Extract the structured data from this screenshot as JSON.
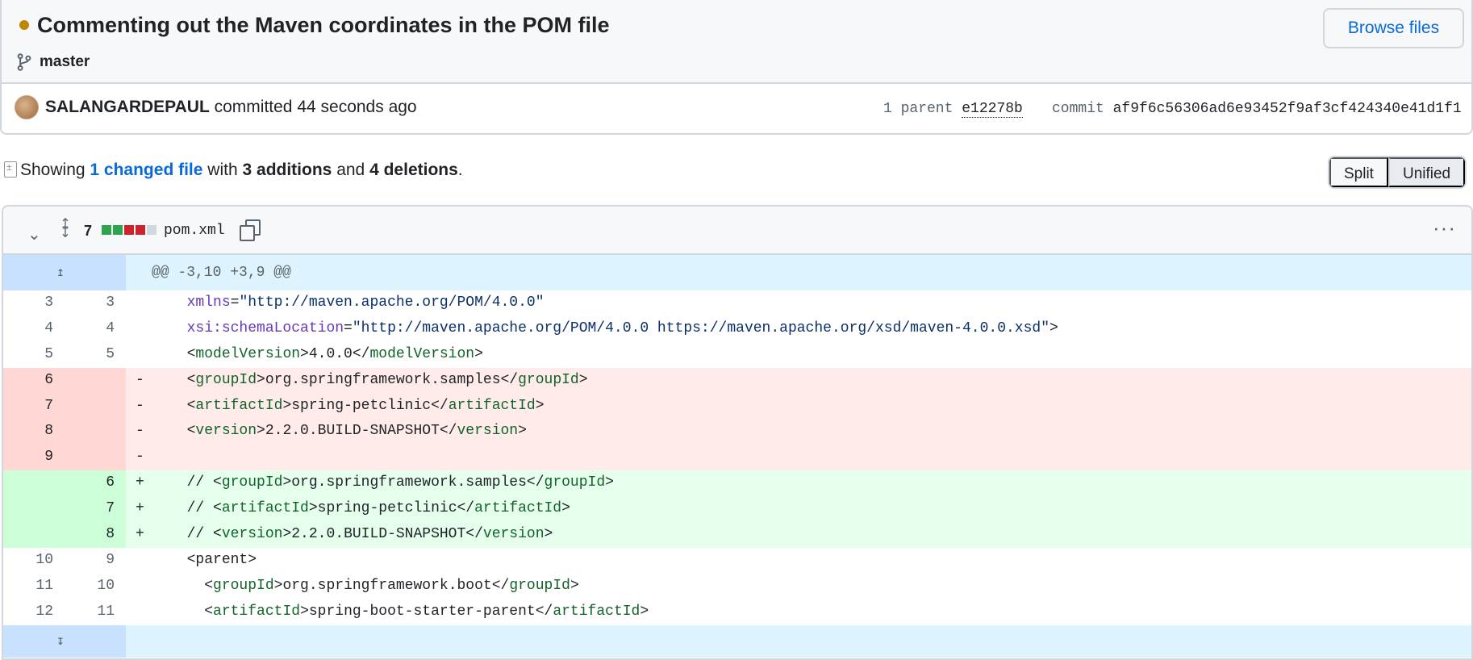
{
  "commit": {
    "title": "Commenting out the Maven coordinates in the POM file",
    "branch": "master",
    "browse_label": "Browse files",
    "author": "SALANGARDEPAUL",
    "committed_text": "committed",
    "time_ago": "44 seconds ago",
    "parent_label": "1 parent",
    "parent_sha": "e12278b",
    "commit_label": "commit",
    "commit_sha": "af9f6c56306ad6e93452f9af3cf424340e41d1f1",
    "status_color": "#bf8700"
  },
  "summary": {
    "prefix": "Showing",
    "changed_link": "1 changed file",
    "with": "with",
    "additions": "3 additions",
    "and": "and",
    "deletions": "4 deletions",
    "suffix": "."
  },
  "view_toggle": {
    "split_label": "Split",
    "unified_label": "Unified",
    "selected": "Unified"
  },
  "file": {
    "change_count": "7",
    "diffstat": [
      "add",
      "add",
      "del",
      "del",
      "neutral"
    ],
    "name": "pom.xml",
    "hunk_header": "@@ -3,10 +3,9 @@"
  },
  "diff_lines": [
    {
      "type": "ctx",
      "old": "3",
      "new": "3",
      "marker": " ",
      "indent": "  ",
      "prefix": "",
      "tokens": [
        [
          "attr",
          "xmlns"
        ],
        [
          "plain",
          "="
        ],
        [
          "str",
          "\"http://maven.apache.org/POM/4.0.0\""
        ]
      ]
    },
    {
      "type": "ctx",
      "old": "4",
      "new": "4",
      "marker": " ",
      "indent": "  ",
      "prefix": "",
      "tokens": [
        [
          "attr",
          "xsi:schemaLocation"
        ],
        [
          "plain",
          "="
        ],
        [
          "str",
          "\"http://maven.apache.org/POM/4.0.0 https://maven.apache.org/xsd/maven-4.0.0.xsd\""
        ],
        [
          "plain",
          ">"
        ]
      ]
    },
    {
      "type": "ctx",
      "old": "5",
      "new": "5",
      "marker": " ",
      "indent": "  ",
      "prefix": "",
      "tokens": [
        [
          "plain",
          "<"
        ],
        [
          "tag",
          "modelVersion"
        ],
        [
          "plain",
          ">4.0.0</"
        ],
        [
          "tag",
          "modelVersion"
        ],
        [
          "plain",
          ">"
        ]
      ]
    },
    {
      "type": "del",
      "old": "6",
      "new": "",
      "marker": "-",
      "indent": "  ",
      "prefix": "",
      "tokens": [
        [
          "plain",
          "<"
        ],
        [
          "tag",
          "groupId"
        ],
        [
          "plain",
          ">org.springframework.samples</"
        ],
        [
          "tag",
          "groupId"
        ],
        [
          "plain",
          ">"
        ]
      ]
    },
    {
      "type": "del",
      "old": "7",
      "new": "",
      "marker": "-",
      "indent": "  ",
      "prefix": "",
      "tokens": [
        [
          "plain",
          "<"
        ],
        [
          "tag",
          "artifactId"
        ],
        [
          "plain",
          ">spring-petclinic</"
        ],
        [
          "tag",
          "artifactId"
        ],
        [
          "plain",
          ">"
        ]
      ]
    },
    {
      "type": "del",
      "old": "8",
      "new": "",
      "marker": "-",
      "indent": "  ",
      "prefix": "",
      "tokens": [
        [
          "plain",
          "<"
        ],
        [
          "tag",
          "version"
        ],
        [
          "plain",
          ">2.2.0.BUILD-SNAPSHOT</"
        ],
        [
          "tag",
          "version"
        ],
        [
          "plain",
          ">"
        ]
      ]
    },
    {
      "type": "del",
      "old": "9",
      "new": "",
      "marker": "-",
      "indent": "",
      "prefix": "",
      "tokens": []
    },
    {
      "type": "add",
      "old": "",
      "new": "6",
      "marker": "+",
      "indent": "  ",
      "prefix": "// ",
      "tokens": [
        [
          "plain",
          "<"
        ],
        [
          "tag",
          "groupId"
        ],
        [
          "plain",
          ">org.springframework.samples</"
        ],
        [
          "tag",
          "groupId"
        ],
        [
          "plain",
          ">"
        ]
      ]
    },
    {
      "type": "add",
      "old": "",
      "new": "7",
      "marker": "+",
      "indent": "  ",
      "prefix": "// ",
      "tokens": [
        [
          "plain",
          "<"
        ],
        [
          "tag",
          "artifactId"
        ],
        [
          "plain",
          ">spring-petclinic</"
        ],
        [
          "tag",
          "artifactId"
        ],
        [
          "plain",
          ">"
        ]
      ]
    },
    {
      "type": "add",
      "old": "",
      "new": "8",
      "marker": "+",
      "indent": "  ",
      "prefix": "// ",
      "tokens": [
        [
          "plain",
          "<"
        ],
        [
          "tag",
          "version"
        ],
        [
          "plain",
          ">2.2.0.BUILD-SNAPSHOT</"
        ],
        [
          "tag",
          "version"
        ],
        [
          "plain",
          ">"
        ]
      ]
    },
    {
      "type": "ctx",
      "old": "10",
      "new": "9",
      "marker": " ",
      "indent": "  ",
      "prefix": "",
      "tokens": [
        [
          "plain",
          "<parent>"
        ]
      ]
    },
    {
      "type": "ctx",
      "old": "11",
      "new": "10",
      "marker": " ",
      "indent": "    ",
      "prefix": "",
      "tokens": [
        [
          "plain",
          "<"
        ],
        [
          "tag",
          "groupId"
        ],
        [
          "plain",
          ">org.springframework.boot</"
        ],
        [
          "tag",
          "groupId"
        ],
        [
          "plain",
          ">"
        ]
      ]
    },
    {
      "type": "ctx",
      "old": "12",
      "new": "11",
      "marker": " ",
      "indent": "    ",
      "prefix": "",
      "tokens": [
        [
          "plain",
          "<"
        ],
        [
          "tag",
          "artifactId"
        ],
        [
          "plain",
          ">spring-boot-starter-parent</"
        ],
        [
          "tag",
          "artifactId"
        ],
        [
          "plain",
          ">"
        ]
      ]
    }
  ],
  "icons": {
    "status": "status-dot",
    "branch": "git-branch-icon",
    "file_diff": "file-diff-icon",
    "chevron": "chevron-down-icon",
    "expand_all": "unfold-icon",
    "copy": "copy-icon",
    "more": "kebab-horizontal-icon",
    "expand_up": "fold-up-icon",
    "expand_down": "fold-down-icon"
  },
  "colors": {
    "link": "#0969da",
    "addition": "#2da44e",
    "deletion": "#cf222e",
    "added_line_bg": "#e6ffec",
    "deleted_line_bg": "#ffebe9",
    "hunk_bg": "#ddf4ff"
  }
}
